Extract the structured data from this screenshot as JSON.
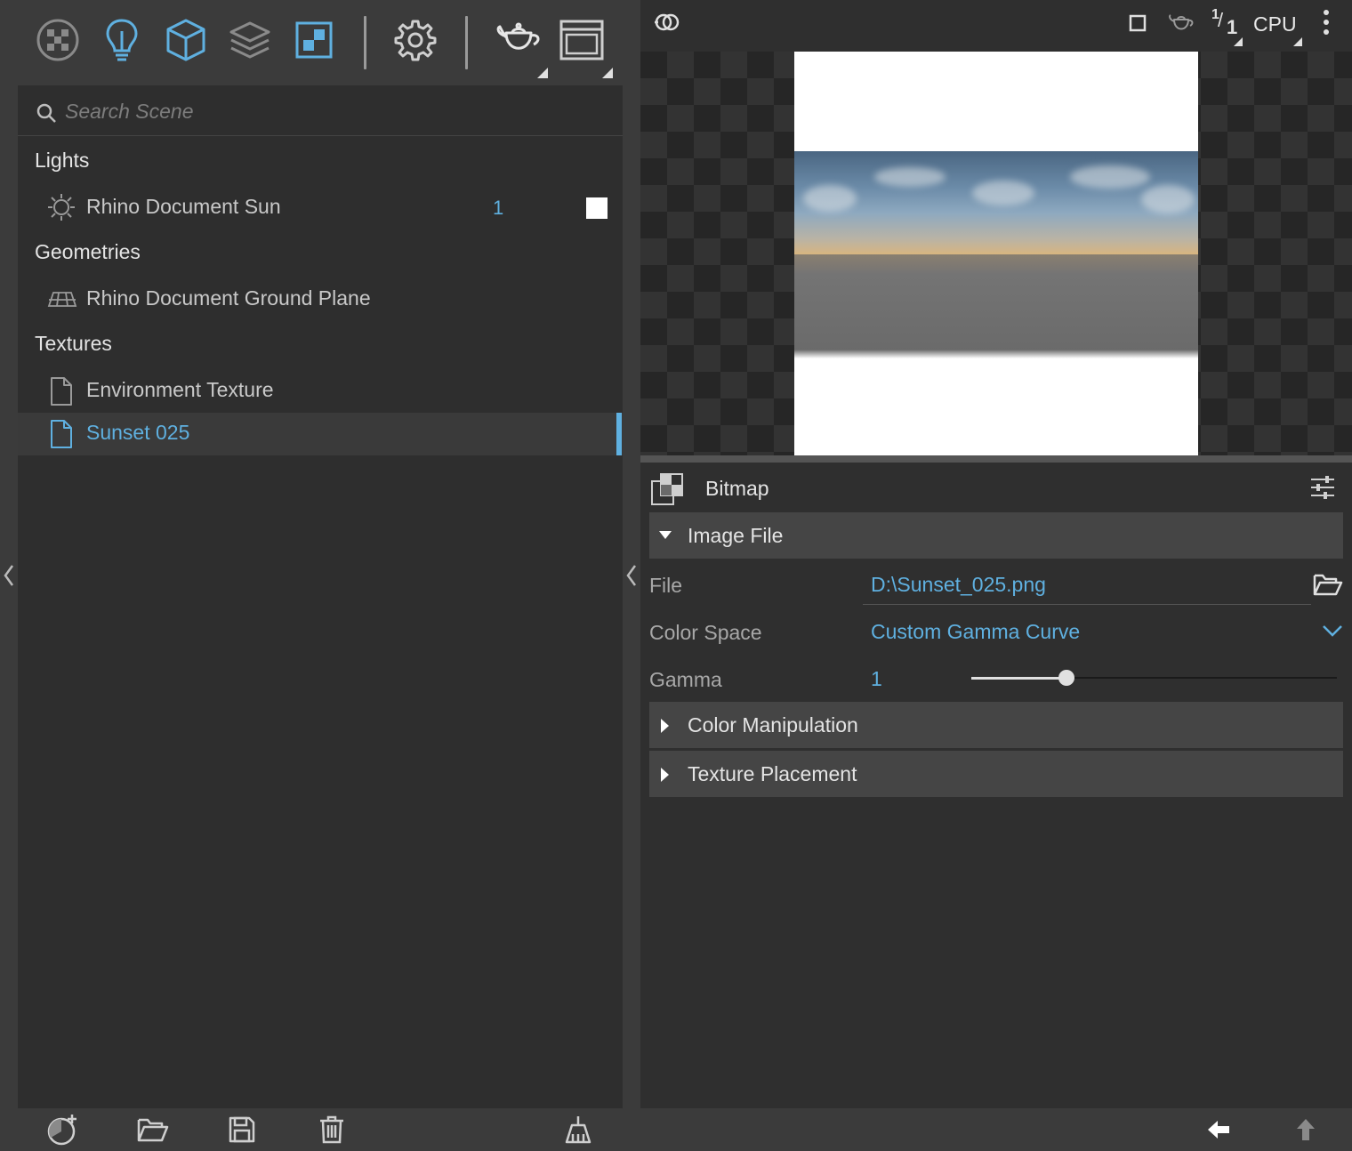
{
  "left_toolbar": {
    "icons": [
      "materials-icon",
      "lights-icon",
      "geometry-icon",
      "layers-icon",
      "textures-icon",
      "settings-icon",
      "teapot-icon",
      "window-icon"
    ]
  },
  "search": {
    "placeholder": "Search Scene"
  },
  "scene_tree": {
    "sections": [
      {
        "title": "Lights",
        "items": [
          {
            "label": "Rhino Document Sun",
            "count": "1",
            "icon": "sun-icon"
          }
        ]
      },
      {
        "title": "Geometries",
        "items": [
          {
            "label": "Rhino Document Ground Plane",
            "icon": "ground-plane-icon"
          }
        ]
      },
      {
        "title": "Textures",
        "items": [
          {
            "label": "Environment Texture",
            "icon": "document-icon",
            "selected": false
          },
          {
            "label": "Sunset 025",
            "icon": "document-icon",
            "selected": true
          }
        ]
      }
    ]
  },
  "left_bottom": {
    "icons": [
      "new-material-icon",
      "open-icon",
      "save-icon",
      "delete-icon",
      "clean-icon"
    ]
  },
  "render_toolbar": {
    "logo_icon": "renderer-logo-icon",
    "resolution": "1/1",
    "resolution_num": "1",
    "resolution_den": "1",
    "device": "CPU"
  },
  "properties": {
    "type_title": "Bitmap",
    "groups": {
      "image_file": "Image File",
      "color_manipulation": "Color Manipulation",
      "texture_placement": "Texture Placement"
    },
    "file": {
      "label": "File",
      "value": "D:\\Sunset_025.png"
    },
    "color_space": {
      "label": "Color Space",
      "value": "Custom Gamma Curve"
    },
    "gamma": {
      "label": "Gamma",
      "value": "1",
      "slider_fraction": 0.26
    }
  },
  "colors": {
    "accent": "#5fb0e0",
    "panel": "#2e2e2e",
    "chrome": "#3b3b3b"
  }
}
